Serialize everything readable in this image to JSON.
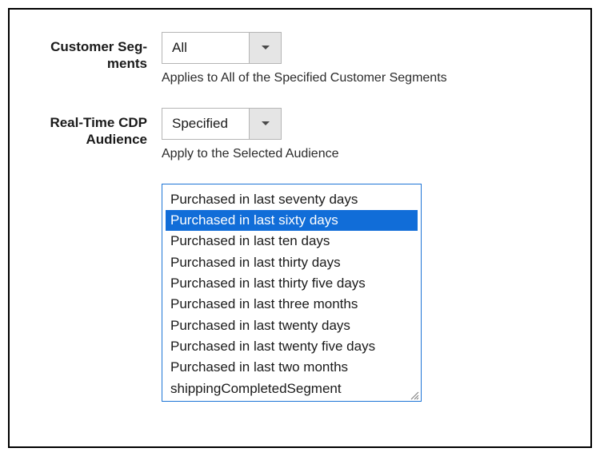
{
  "segments": {
    "label": "Customer Seg-\nments",
    "dropdown_value": "All",
    "helper": "Applies to All of the Specified Customer Segments"
  },
  "audience": {
    "label": "Real-Time CDP Audience",
    "dropdown_value": "Specified",
    "helper": "Apply to the Selected Audience",
    "options": [
      "Purchased in last seventy days",
      "Purchased in last sixty days",
      "Purchased in last ten days",
      "Purchased in last thirty days",
      "Purchased in last thirty five days",
      "Purchased in last three months",
      "Purchased in last twenty days",
      "Purchased in last twenty five days",
      "Purchased in last two months",
      "shippingCompletedSegment"
    ],
    "selected_index": 1
  }
}
